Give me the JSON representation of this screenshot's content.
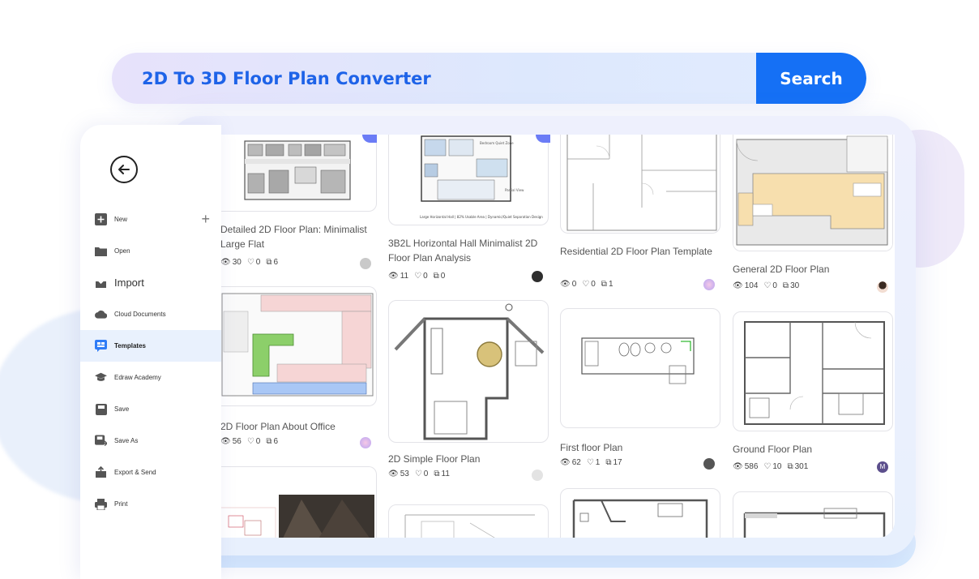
{
  "search": {
    "query": "2D To 3D Floor Plan Converter",
    "button_label": "Search"
  },
  "sidebar": {
    "items": [
      {
        "label": "New",
        "icon": "plus-square-icon"
      },
      {
        "label": "Open",
        "icon": "folder-icon"
      },
      {
        "label": "Import",
        "icon": "import-icon"
      },
      {
        "label": "Cloud Documents",
        "icon": "cloud-icon"
      },
      {
        "label": "Templates",
        "icon": "templates-icon",
        "active": true
      },
      {
        "label": "Edraw Academy",
        "icon": "graduation-cap-icon"
      },
      {
        "label": "Save",
        "icon": "save-icon"
      },
      {
        "label": "Save As",
        "icon": "save-as-icon"
      },
      {
        "label": "Export & Send",
        "icon": "export-icon"
      },
      {
        "label": "Print",
        "icon": "print-icon"
      }
    ]
  },
  "templates": [
    {
      "title": "Detailed 2D Floor Plan: Minimalist Large Flat",
      "views": "30",
      "likes": "0",
      "copies": "6"
    },
    {
      "title": "3B2L Horizontal Hall Minimalist 2D Floor Plan Analysis",
      "views": "11",
      "likes": "0",
      "copies": "0"
    },
    {
      "title": "Residential 2D Floor Plan Template",
      "views": "0",
      "likes": "0",
      "copies": "1"
    },
    {
      "title": "General 2D Floor Plan",
      "views": "104",
      "likes": "0",
      "copies": "30"
    },
    {
      "title": "2D Floor Plan About Office",
      "views": "56",
      "likes": "0",
      "copies": "6"
    },
    {
      "title": "2D Simple Floor Plan",
      "views": "53",
      "likes": "0",
      "copies": "11"
    },
    {
      "title": "First floor Plan",
      "views": "62",
      "likes": "1",
      "copies": "17"
    },
    {
      "title": "Ground Floor Plan",
      "views": "586",
      "likes": "10",
      "copies": "301"
    }
  ],
  "avatar_initial": "M",
  "colors": {
    "accent": "#1570f5",
    "query_text": "#1e63e8",
    "active_bg": "#e9f1fd"
  }
}
